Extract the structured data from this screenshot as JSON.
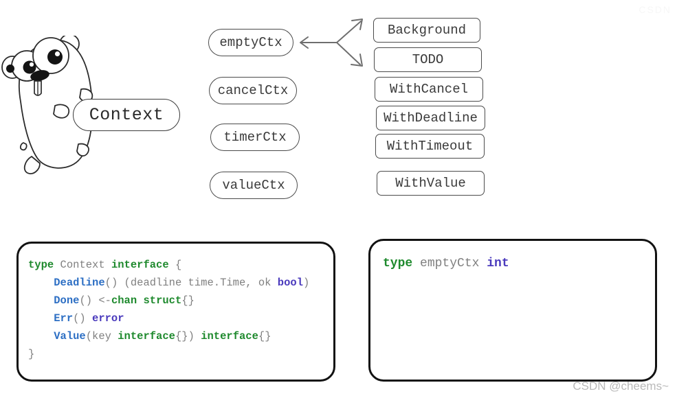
{
  "mascot": {
    "name": "go-gopher",
    "label": "Context"
  },
  "ctx_types": {
    "title": "context implementations",
    "items": [
      {
        "label": "emptyCtx"
      },
      {
        "label": "cancelCtx"
      },
      {
        "label": "timerCtx"
      },
      {
        "label": "valueCtx"
      }
    ]
  },
  "ctx_functions": {
    "title": "context package functions",
    "items": [
      {
        "label": "Background"
      },
      {
        "label": "TODO"
      },
      {
        "label": "WithCancel"
      },
      {
        "label": "WithDeadline"
      },
      {
        "label": "WithTimeout"
      },
      {
        "label": "WithValue"
      }
    ]
  },
  "arrow": {
    "name": "three-way-branch-arrow"
  },
  "code_left": {
    "lines": [
      [
        {
          "t": "type",
          "c": "kw"
        },
        {
          "t": " Context ",
          "c": "plain"
        },
        {
          "t": "interface",
          "c": "kw"
        },
        {
          "t": " {",
          "c": "plain"
        }
      ],
      [
        {
          "t": "    ",
          "c": "plain"
        },
        {
          "t": "Deadline",
          "c": "fn"
        },
        {
          "t": "() (deadline time.Time, ok ",
          "c": "plain"
        },
        {
          "t": "bool",
          "c": "type"
        },
        {
          "t": ")",
          "c": "plain"
        }
      ],
      [
        {
          "t": "    ",
          "c": "plain"
        },
        {
          "t": "Done",
          "c": "fn"
        },
        {
          "t": "() <-",
          "c": "plain"
        },
        {
          "t": "chan struct",
          "c": "kw"
        },
        {
          "t": "{}",
          "c": "plain"
        }
      ],
      [
        {
          "t": "    ",
          "c": "plain"
        },
        {
          "t": "Err",
          "c": "fn"
        },
        {
          "t": "() ",
          "c": "plain"
        },
        {
          "t": "error",
          "c": "type"
        }
      ],
      [
        {
          "t": "    ",
          "c": "plain"
        },
        {
          "t": "Value",
          "c": "fn"
        },
        {
          "t": "(key ",
          "c": "plain"
        },
        {
          "t": "interface",
          "c": "kw"
        },
        {
          "t": "{}) ",
          "c": "plain"
        },
        {
          "t": "interface",
          "c": "kw"
        },
        {
          "t": "{}",
          "c": "plain"
        }
      ],
      [
        {
          "t": "}",
          "c": "plain"
        }
      ]
    ]
  },
  "code_right": {
    "lines": [
      [
        {
          "t": "type",
          "c": "kw"
        },
        {
          "t": " emptyCtx ",
          "c": "plain"
        },
        {
          "t": "int",
          "c": "type"
        }
      ]
    ]
  },
  "watermarks": {
    "bottom_right": "CSDN @cheems~",
    "top_right": "CSDN"
  },
  "colors": {
    "keyword_green": "#1f8a2e",
    "function_blue": "#2d6fc4",
    "type_purple": "#4b3bbd",
    "plain_gray": "#808080",
    "outline_black": "#121212",
    "shape_stroke": "#4a4a4a"
  }
}
